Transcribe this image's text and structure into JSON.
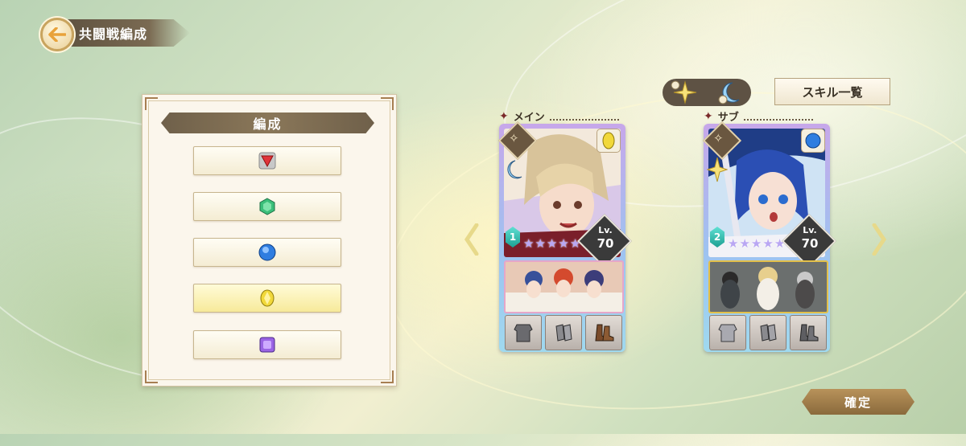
{
  "header": {
    "title": "共闘戦編成"
  },
  "formation": {
    "title": "編成",
    "slots": [
      {
        "gem": "red-triangle-gem-icon",
        "selected": false
      },
      {
        "gem": "green-hexagon-gem-icon",
        "selected": false
      },
      {
        "gem": "blue-circle-gem-icon",
        "selected": false
      },
      {
        "gem": "yellow-diamond-gem-icon",
        "selected": true
      },
      {
        "gem": "purple-square-gem-icon",
        "selected": false
      }
    ]
  },
  "skill_mode": {
    "toggle_labels": [
      "I",
      "II"
    ]
  },
  "skill_list_label": "スキル一覧",
  "main": {
    "label": "メイン",
    "level_prefix": "Lv.",
    "level": "70",
    "rank": "1",
    "stars": 5,
    "element_color": "#f1d83a",
    "skill_mark": "II"
  },
  "sub": {
    "label": "サブ",
    "level_prefix": "Lv.",
    "level": "70",
    "rank": "2",
    "stars": 5,
    "element_color": "#2f7de0",
    "skill_mark": "I"
  },
  "confirm_label": "確定"
}
